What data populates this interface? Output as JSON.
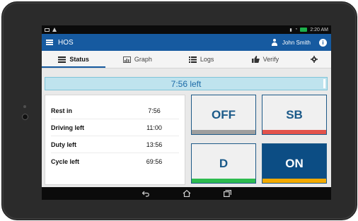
{
  "statusbar": {
    "time": "2:20 AM"
  },
  "app": {
    "title": "HOS",
    "user": "John Smith"
  },
  "tabs": [
    {
      "label": "Status",
      "icon": "status-icon",
      "active": true
    },
    {
      "label": "Graph",
      "icon": "graph-icon",
      "active": false
    },
    {
      "label": "Logs",
      "icon": "logs-icon",
      "active": false
    },
    {
      "label": "Verify",
      "icon": "thumbs-up-icon",
      "active": false
    },
    {
      "label": "",
      "icon": "gear-icon",
      "active": false
    }
  ],
  "banner": {
    "text": "7:56 left"
  },
  "summary": {
    "rows": [
      {
        "label": "Rest in",
        "value": "7:56"
      },
      {
        "label": "Driving left",
        "value": "11:00"
      },
      {
        "label": "Duty left",
        "value": "13:56"
      },
      {
        "label": "Cycle left",
        "value": "69:56"
      }
    ]
  },
  "duty_buttons": [
    {
      "label": "OFF",
      "bar_color": "#9e9e9e",
      "selected": false
    },
    {
      "label": "SB",
      "bar_color": "#e2524b",
      "selected": false
    },
    {
      "label": "D",
      "bar_color": "#2dbb4f",
      "selected": false
    },
    {
      "label": "ON",
      "bar_color": "#f2a900",
      "selected": true
    }
  ],
  "colors": {
    "app_bar": "#165aa0",
    "banner_bg": "#bfe3ee",
    "banner_text": "#1b6aa7"
  }
}
